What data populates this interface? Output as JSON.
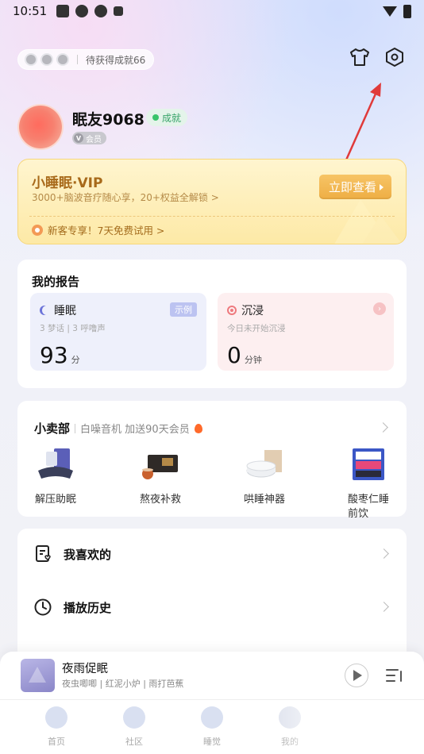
{
  "status_bar": {
    "time": "10:51"
  },
  "header": {
    "achievement_pill": "待获得成就66",
    "icons": [
      "shirt-icon",
      "settings-icon"
    ]
  },
  "profile": {
    "nickname": "眠友9068",
    "achievement_tag": "成就",
    "member_tag": "会员"
  },
  "vip": {
    "title": "小睡眠·VIP",
    "subtitle": "3000+脑波音疗随心享，20+权益全解锁 >",
    "button": "立即查看",
    "trial": "新客专享！7天免费试用 >"
  },
  "report": {
    "title": "我的报告",
    "sleep": {
      "title": "睡眠",
      "tag": "示例",
      "sub": "3 梦话 | 3 呼噜声",
      "value": "93",
      "unit": "分"
    },
    "immerse": {
      "title": "沉浸",
      "sub": "今日未开始沉浸",
      "value": "0",
      "unit": "分钟"
    }
  },
  "shop": {
    "title": "小卖部",
    "promo": "白噪音机 加送90天会员",
    "items": [
      {
        "label": "解压助眠"
      },
      {
        "label": "熬夜补救"
      },
      {
        "label": "哄睡神器"
      },
      {
        "label": "酸枣仁睡前饮"
      }
    ]
  },
  "list": {
    "items": [
      {
        "label": "我喜欢的",
        "icon": "favorites-icon"
      },
      {
        "label": "播放历史",
        "icon": "history-icon"
      }
    ]
  },
  "player": {
    "title": "夜雨促眠",
    "subtitle": "夜虫唧唧 | 红泥小炉 | 雨打芭蕉"
  },
  "bottom_nav": {
    "items": [
      {
        "label": "首页"
      },
      {
        "label": "社区"
      },
      {
        "label": "睡觉"
      },
      {
        "label": "我的"
      }
    ]
  },
  "colors": {
    "vip_gold": "#eeae44",
    "annotation_red": "#e03a3a",
    "sleep_accent": "#6b73d9",
    "immerse_accent": "#ee7a7e"
  }
}
